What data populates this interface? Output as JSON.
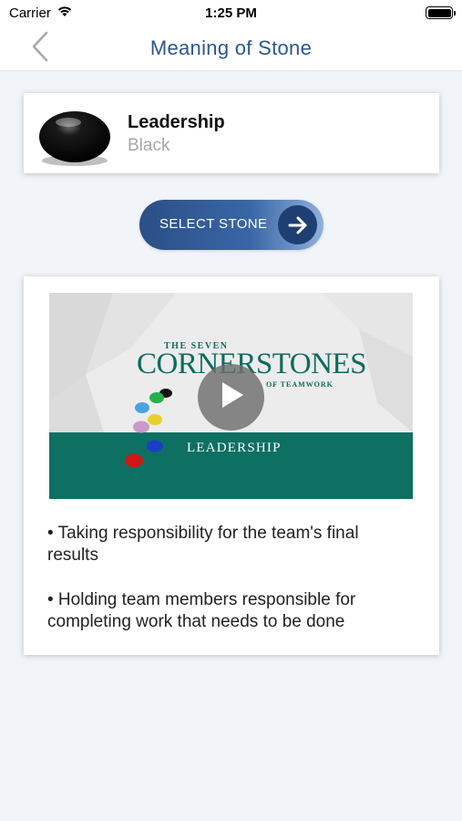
{
  "status_bar": {
    "carrier": "Carrier",
    "time": "1:25 PM",
    "battery_level": 1.0
  },
  "nav": {
    "title": "Meaning of Stone",
    "back_icon": "chevron-left-icon"
  },
  "stone": {
    "name": "Leadership",
    "color": "Black"
  },
  "select_button": {
    "label": "SELECT STONE",
    "icon": "arrow-right-icon"
  },
  "video": {
    "brand_top": "THE SEVEN",
    "brand_main": "CORNERSTONES",
    "brand_sub": "OF TEAMWORK",
    "band_label": "LEADERSHIP",
    "play_icon": "play-icon"
  },
  "bullets": [
    "• Taking responsibility for the team's final results",
    "• Holding team members responsible for completing work that needs to be done"
  ],
  "colors": {
    "accent": "#2d5691",
    "button_dark": "#1f3f72",
    "teal": "#0e7062",
    "background": "#f1f5fa"
  }
}
